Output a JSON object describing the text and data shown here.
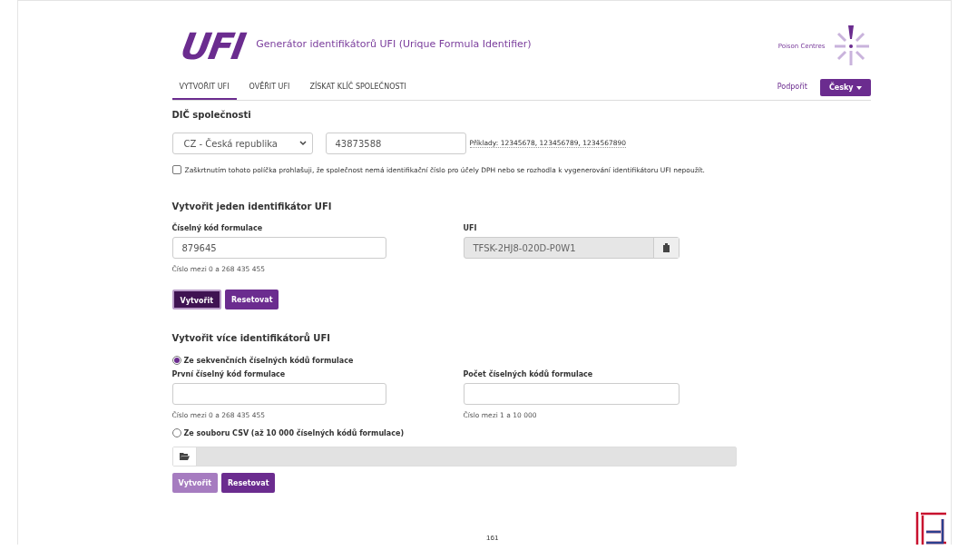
{
  "header": {
    "logo": "UFI",
    "title": "Generátor identifikátorů UFI (Urique Formula Identifier)",
    "partner": "Poison Centres"
  },
  "tabs": [
    {
      "label": "VYTVOŘIT UFI",
      "selected": true
    },
    {
      "label": "OVĚŘIT UFI",
      "selected": false
    },
    {
      "label": "ZÍSKAT KLÍČ SPOLEČNOSTI",
      "selected": false
    }
  ],
  "support_link": "Podpořit",
  "language_button": "Česky",
  "company_vat": {
    "heading": "DIČ společnosti",
    "country": "CZ - Česká republika",
    "vat_number": "43873588",
    "examples": "Příklady: 12345678, 123456789, 1234567890",
    "no_vat_checked": false,
    "no_vat_label": "Zaškrtnutím tohoto políčka prohlašuji, že společnost nemá identifikační číslo pro účely DPH nebo se rozhodla k vygenerování identifikátoru UFI nepoužít."
  },
  "single": {
    "heading": "Vytvořit jeden identifikátor UFI",
    "code_label": "Číselný kód formulace",
    "code_value": "879645",
    "code_hint": "Číslo mezi 0 a 268 435 455",
    "ufi_label": "UFI",
    "ufi_value": "TFSK-2HJ8-020D-P0W1",
    "buttons": [
      {
        "label": "Vytvořit",
        "active": true,
        "disabled": false
      },
      {
        "label": "Resetovat",
        "active": false,
        "disabled": false
      }
    ]
  },
  "multiple": {
    "heading": "Vytvořit více identifikátorů UFI",
    "sequential": {
      "label": "Ze sekvenčních číselných kódů formulace",
      "selected": true
    },
    "first_label": "První číselný kód formulace",
    "first_hint": "Číslo mezi 0 a 268 435 455",
    "count_label": "Počet číselných kódů formulace",
    "count_hint": "Číslo mezi 1 a 10 000",
    "csv": {
      "label": "Ze souboru CSV (až 10 000 číselných kódů formulace)",
      "selected": false
    },
    "buttons": [
      {
        "label": "Vytvořit",
        "active": false,
        "disabled": true
      },
      {
        "label": "Resetovat",
        "active": false,
        "disabled": false
      }
    ]
  },
  "page_number": "161"
}
